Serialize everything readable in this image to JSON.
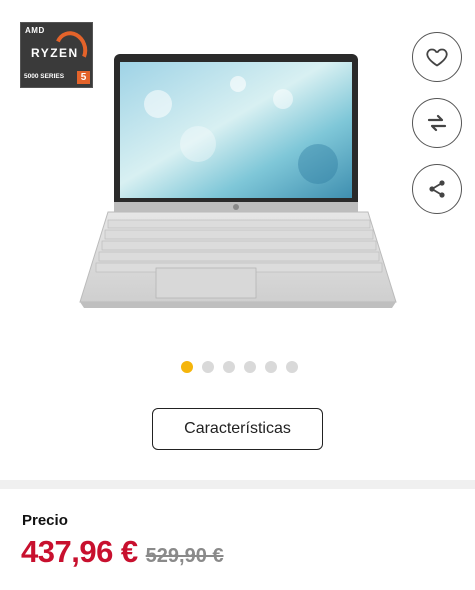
{
  "badge": {
    "brand": "AMD",
    "product": "RYZEN",
    "series": "5000 SERIES",
    "tier": "5",
    "accent_color": "#e4632a"
  },
  "actions": {
    "favorite_icon": "heart-icon",
    "compare_icon": "compare-arrows-icon",
    "share_icon": "share-icon"
  },
  "gallery": {
    "image": "laptop-product-image",
    "total_images": 6,
    "active_index": 0,
    "active_color": "#f5b50b"
  },
  "features_button_label": "Características",
  "price": {
    "label": "Precio",
    "current": "437,96 €",
    "original": "529,90 €",
    "current_color": "#c8102e"
  }
}
